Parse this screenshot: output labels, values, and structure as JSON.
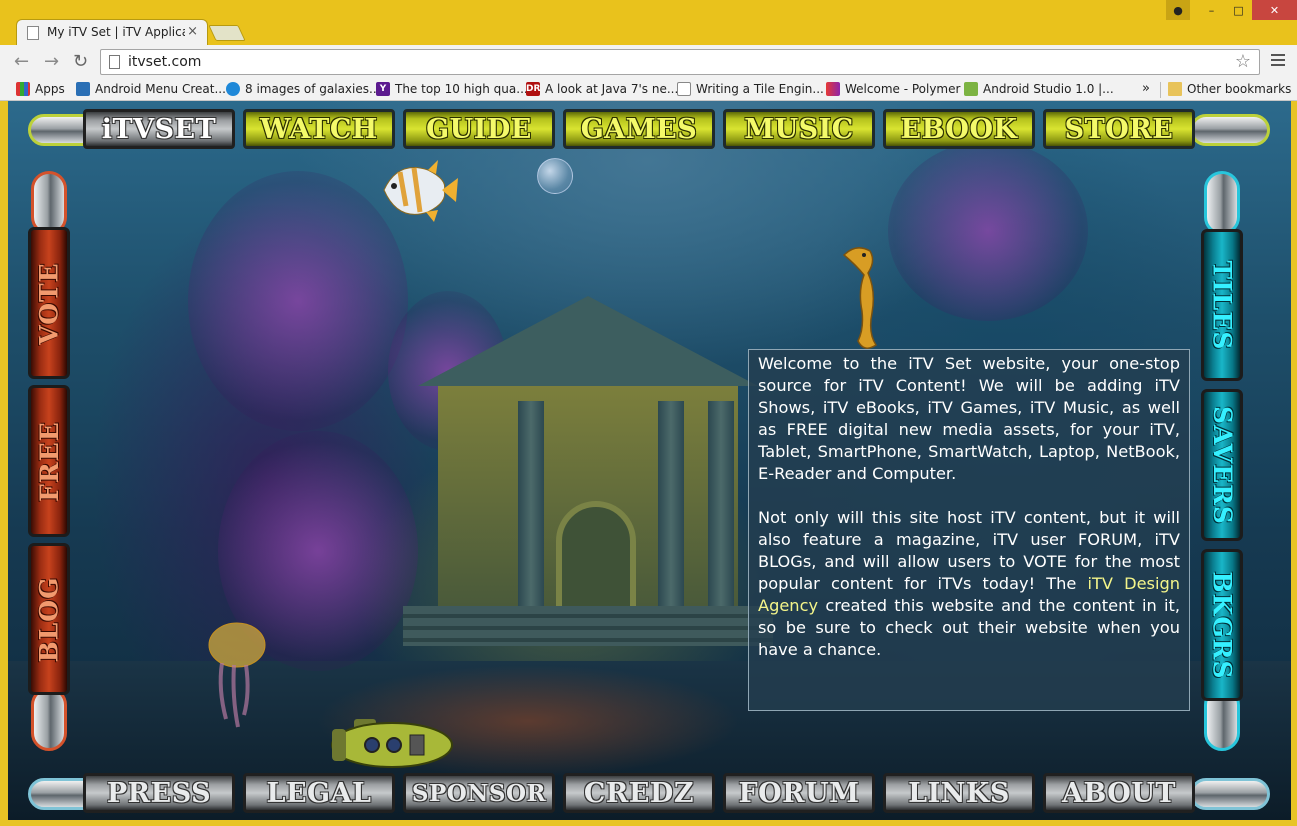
{
  "browser": {
    "tab_title": "My iTV Set | iTV Applicatio",
    "url": "itvset.com",
    "bookmarks": [
      {
        "label": "Apps",
        "icon": "apps-grid-icon"
      },
      {
        "label": "Android Menu Creat...",
        "icon": "android-studio-icon"
      },
      {
        "label": "8 images of galaxies...",
        "icon": "mnn-icon"
      },
      {
        "label": "The top 10 high qua...",
        "icon": "yahoo-icon"
      },
      {
        "label": "A look at Java 7's ne...",
        "icon": "dr-icon"
      },
      {
        "label": "Writing a Tile Engin...",
        "icon": "page-icon"
      },
      {
        "label": "Welcome - Polymer",
        "icon": "polymer-icon"
      },
      {
        "label": "Android Studio 1.0 |...",
        "icon": "android-icon"
      }
    ],
    "bookmarks_overflow": "»",
    "other_bookmarks": "Other bookmarks"
  },
  "site": {
    "top_nav": [
      "iTVSET",
      "WATCH",
      "GUIDE",
      "GAMES",
      "MUSIC",
      "EBOOK",
      "STORE"
    ],
    "bottom_nav": [
      "PRESS",
      "LEGAL",
      "SPONSOR",
      "CREDZ",
      "FORUM",
      "LINKS",
      "ABOUT"
    ],
    "left_nav": [
      "VOTE",
      "FREE",
      "BLOG"
    ],
    "right_nav": [
      "TILES",
      "SAVERS",
      "BKGRS"
    ],
    "intro_paragraph": "Welcome to the iTV Set website, your one-stop source for iTV Content! We will be adding iTV Shows, iTV eBooks, iTV Games, iTV Music, as well as FREE digital new media assets, for your iTV, Tablet, SmartPhone, SmartWatch, Laptop, NetBook, E-Reader and Computer.",
    "second_paragraph_before": "Not only will this site host iTV content, but it will also feature a magazine, iTV user FORUM, iTV BLOGs, and will allow users to VOTE for the most popular content for iTVs today! The ",
    "agency_link": "iTV Design Agency",
    "second_paragraph_after": " created this website and the content in it, so be sure to check out their website when you have a chance."
  },
  "colors": {
    "chrome": "#e9c21c",
    "nav_lime": "#d9e431",
    "nav_red": "#c7421d",
    "nav_cyan": "#19b6c8",
    "link": "#f4f58a"
  }
}
